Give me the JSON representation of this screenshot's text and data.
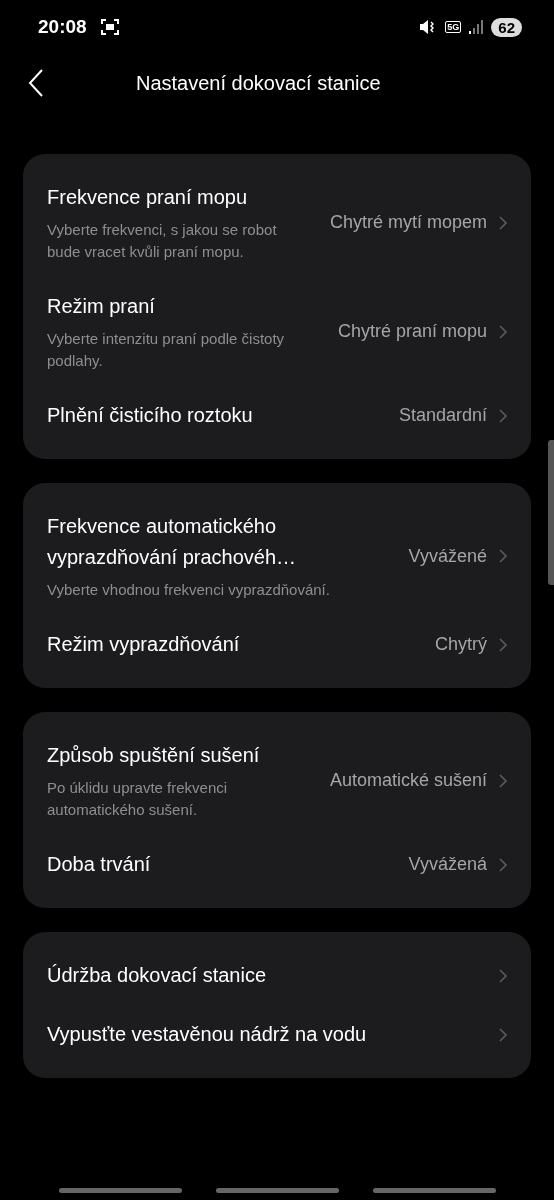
{
  "status_bar": {
    "time": "20:08",
    "network": "5G",
    "battery": "62"
  },
  "header": {
    "title": "Nastavení dokovací stanice"
  },
  "cards": [
    {
      "rows": [
        {
          "title": "Frekvence praní mopu",
          "description": "Vyberte frekvenci, s jakou se robot bude vracet kvůli praní mopu.",
          "value": "Chytré mytí mopem"
        },
        {
          "title": "Režim praní",
          "description": "Vyberte intenzitu praní podle čistoty podlahy.",
          "value": "Chytré praní mopu"
        },
        {
          "title": "Plnění čisticího roztoku",
          "value": "Standardní"
        }
      ]
    },
    {
      "rows": [
        {
          "title": "Frekvence automatického vyprazdňování prachovéh…",
          "description": "Vyberte vhodnou frekvenci vyprazdňování.",
          "value": "Vyvážené"
        },
        {
          "title": "Režim vyprazdňování",
          "value": "Chytrý"
        }
      ]
    },
    {
      "rows": [
        {
          "title": "Způsob spuštění sušení",
          "description": "Po úklidu upravte frekvenci automatického sušení.",
          "value": "Automatické sušení"
        },
        {
          "title": "Doba trvání",
          "value": "Vyvážená"
        }
      ]
    },
    {
      "rows": [
        {
          "title": "Údržba dokovací stanice"
        },
        {
          "title": "Vypusťte vestavěnou nádrž na vodu"
        }
      ]
    }
  ]
}
